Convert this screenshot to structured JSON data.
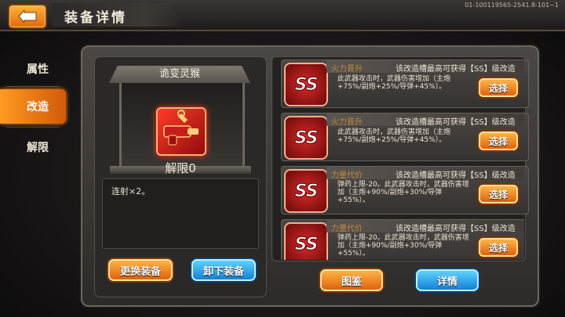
{
  "header": {
    "title": "装备详情",
    "ref_code": "01-100119565-2541.8-101~1",
    "back_icon": "back-arrow-icon"
  },
  "sidebar": {
    "tabs": [
      {
        "label": "属性"
      },
      {
        "label": "改造"
      },
      {
        "label": "解限"
      }
    ],
    "active_tab": "改造"
  },
  "equipment": {
    "name": "诡变灵猴",
    "unlock_level": "解限0",
    "description": "连射×2。",
    "icon": "gun-weapon-icon"
  },
  "actions": {
    "replace_label": "更换装备",
    "unequip_label": "卸下装备",
    "catalog_label": "图鉴",
    "details_label": "详情"
  },
  "mods": [
    {
      "badge": "SS",
      "title": "火力晋升",
      "hint": "该改造槽最高可获得【SS】级改造",
      "body": "此武器攻击时，武器伤害增加（主炮+75%/副炮+25%/导弹+45%）。",
      "button": "选择"
    },
    {
      "badge": "SS",
      "title": "火力晋升",
      "hint": "该改造槽最高可获得【SS】级改造",
      "body": "此武器攻击时，武器伤害增加（主炮+75%/副炮+25%/导弹+45%）。",
      "button": "选择"
    },
    {
      "badge": "SS",
      "title": "力量代价",
      "hint": "该改造槽最高可获得【SS】级改造",
      "body": "弹药上限-20。此武器攻击时，武器伤害增加（主炮+90%/副炮+30%/导弹+55%）。",
      "button": "选择"
    },
    {
      "badge": "SS",
      "title": "力量代价",
      "hint": "该改造槽最高可获得【SS】级改造",
      "body": "弹药上限-20。此武器攻击时，武器伤害增加（主炮+90%/副炮+30%/导弹+55%）。",
      "button": "选择"
    }
  ],
  "colors": {
    "accent_orange": "#f07a14",
    "accent_blue": "#1e90e0",
    "mod_title": "#c08a3c"
  }
}
